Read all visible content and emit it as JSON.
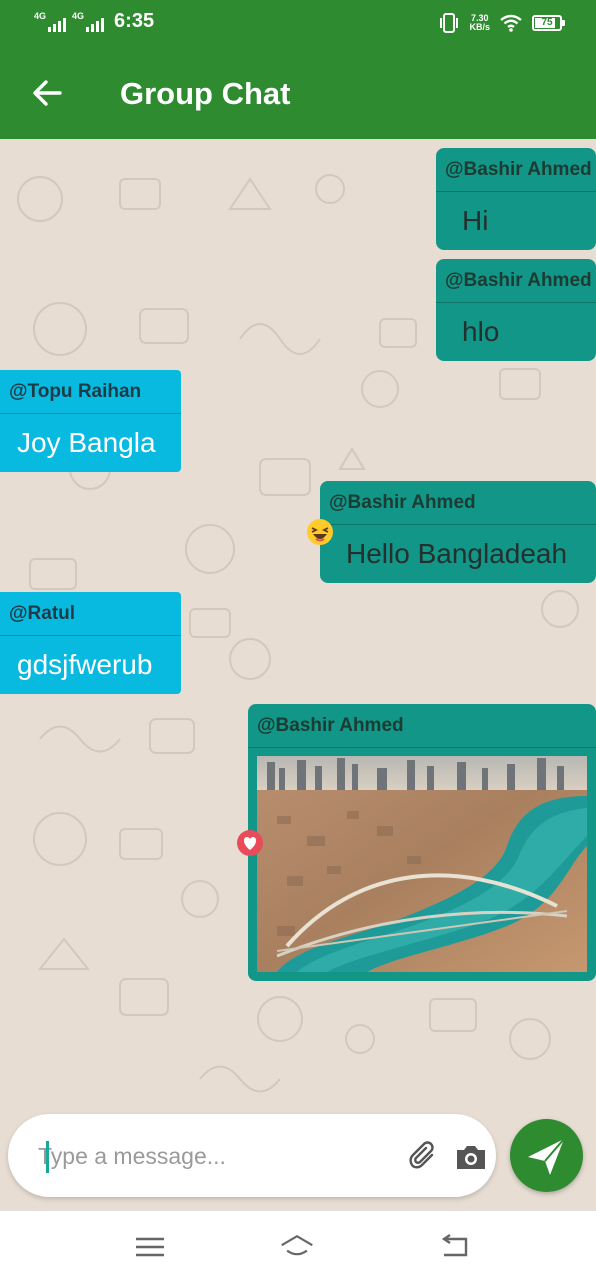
{
  "status_bar": {
    "network_1": "4G",
    "network_2": "4G",
    "time": "6:35",
    "speed_value": "7.30",
    "speed_unit": "KB/s",
    "battery": "75"
  },
  "toolbar": {
    "title": "Group Chat",
    "back_icon": "arrow-left-icon",
    "background": "#2e8b2f"
  },
  "messages": [
    {
      "sender": "@Bashir Ahmed",
      "text": "Hi",
      "direction": "outgoing"
    },
    {
      "sender": "@Bashir Ahmed",
      "text": "hlo",
      "direction": "outgoing"
    },
    {
      "sender": "@Topu Raihan",
      "text": "Joy Bangla",
      "direction": "incoming"
    },
    {
      "sender": "@Bashir Ahmed",
      "text": "Hello Bangladeah",
      "direction": "outgoing",
      "reaction": "laughing-emoji-icon"
    },
    {
      "sender": "@Ratul",
      "text": "gdsjfwerub",
      "direction": "incoming"
    },
    {
      "sender": "@Bashir Ahmed",
      "image": "aerial-city-canal-bridge-photo",
      "direction": "outgoing",
      "reaction": "heart-icon"
    }
  ],
  "colors": {
    "outgoing_bubble": "#129687",
    "incoming_bubble": "#08b9e0",
    "chat_background": "#e7ddd3",
    "send_button": "#2e8b2f"
  },
  "composer": {
    "placeholder": "Type a message...",
    "value": "",
    "attach_icon": "paperclip-icon",
    "camera_icon": "camera-icon",
    "send_icon": "send-icon"
  },
  "navigation": {
    "menu_icon": "menu-icon",
    "home_icon": "home-icon",
    "back_icon": "back-icon"
  }
}
